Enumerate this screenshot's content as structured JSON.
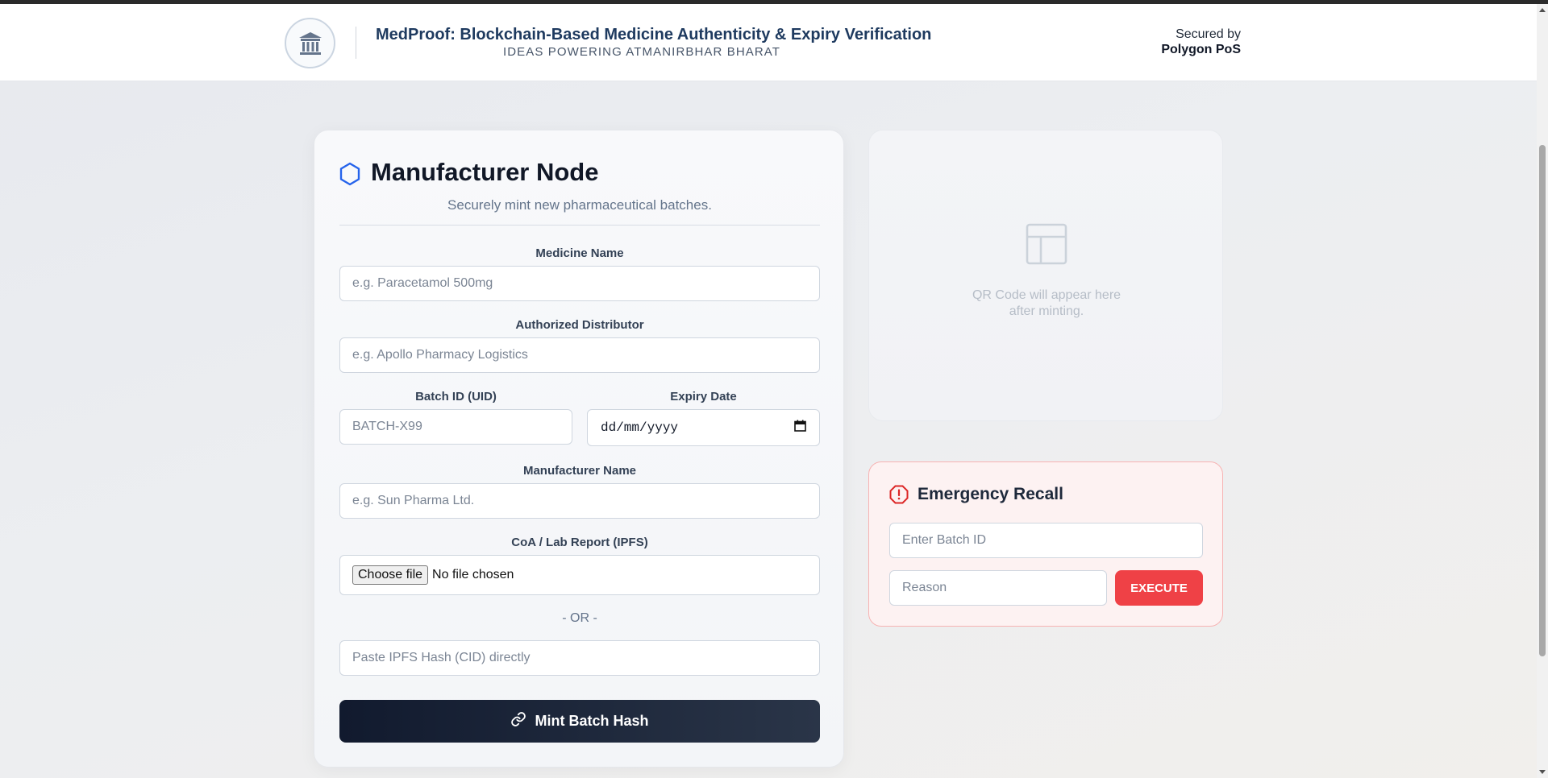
{
  "header": {
    "title": "MedProof: Blockchain-Based Medicine Authenticity & Expiry Verification",
    "subtitle": "IDEAS POWERING ATMANIRBHAR BHARAT",
    "secured_label": "Secured by",
    "secured_value": "Polygon PoS"
  },
  "manufacturer": {
    "title": "Manufacturer Node",
    "subtitle": "Securely mint new pharmaceutical batches.",
    "medicine_name": {
      "label": "Medicine Name",
      "placeholder": "e.g. Paracetamol 500mg"
    },
    "distributor": {
      "label": "Authorized Distributor",
      "placeholder": "e.g. Apollo Pharmacy Logistics"
    },
    "batch_id": {
      "label": "Batch ID (UID)",
      "placeholder": "BATCH-X99"
    },
    "expiry": {
      "label": "Expiry Date",
      "value": "dd/mm/yyyy"
    },
    "manufacturer_name": {
      "label": "Manufacturer Name",
      "placeholder": "e.g. Sun Pharma Ltd."
    },
    "report": {
      "label": "CoA / Lab Report (IPFS)",
      "button": "Choose file",
      "status": "No file chosen"
    },
    "or_text": "- OR -",
    "ipfs_hash": {
      "placeholder": "Paste IPFS Hash (CID) directly"
    },
    "mint_button": "Mint Batch Hash"
  },
  "qr": {
    "line1": "QR Code will appear here",
    "line2": "after minting."
  },
  "recall": {
    "title": "Emergency Recall",
    "batch_placeholder": "Enter Batch ID",
    "reason_placeholder": "Reason",
    "execute_button": "EXECUTE"
  },
  "colors": {
    "accent_blue": "#2563eb",
    "danger": "#ef4146",
    "dark": "#111a2e"
  }
}
